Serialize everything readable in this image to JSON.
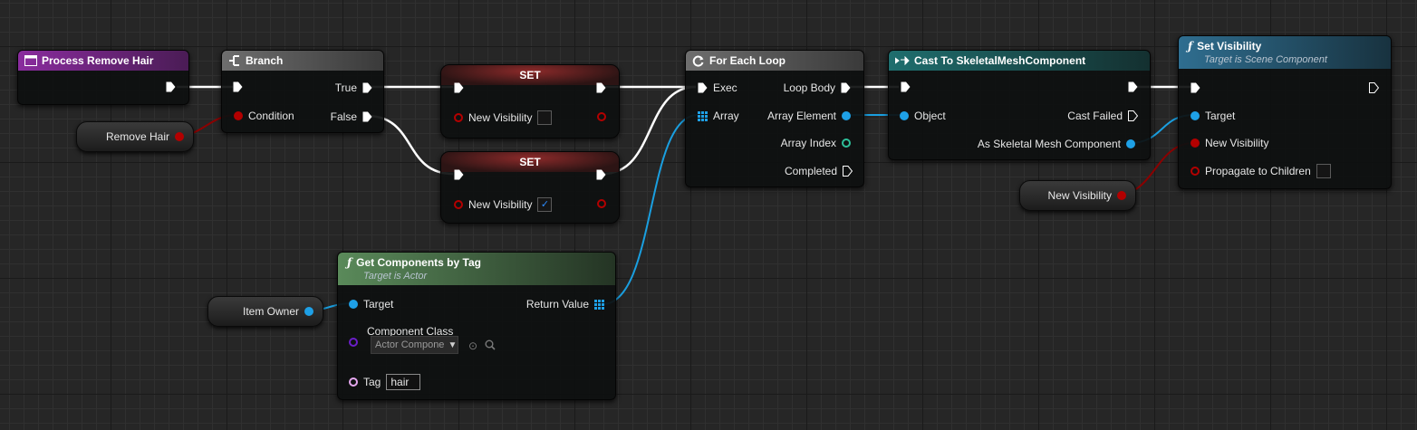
{
  "colors": {
    "event_header": "#8a2c9e",
    "branch_header": "#6e6e6e",
    "set_header": "#9b2424",
    "loop_header": "#6e6e6e",
    "cast_header": "#1f6e6e",
    "function_header": "#2c6e8c",
    "pure_function_header": "#4f7a4f",
    "exec_wire": "#ffffff",
    "bool_wire": "#8b0000",
    "object_wire": "#1a9fe0"
  },
  "nodes": {
    "event": {
      "title": "Process Remove Hair"
    },
    "branch": {
      "title": "Branch",
      "true_label": "True",
      "false_label": "False",
      "condition_label": "Condition"
    },
    "set_true": {
      "title": "SET",
      "pin_label": "New Visibility",
      "checked": false
    },
    "set_false": {
      "title": "SET",
      "pin_label": "New Visibility",
      "checked": true,
      "check_glyph": "✓"
    },
    "foreach": {
      "title": "For Each Loop",
      "exec": "Exec",
      "array": "Array",
      "loop_body": "Loop Body",
      "array_element": "Array Element",
      "array_index": "Array Index",
      "completed": "Completed"
    },
    "cast": {
      "title": "Cast To SkeletalMeshComponent",
      "object": "Object",
      "cast_failed": "Cast Failed",
      "as_output": "As Skeletal Mesh Component"
    },
    "set_visibility": {
      "title": "Set Visibility",
      "subtitle": "Target is Scene Component",
      "target": "Target",
      "new_visibility": "New Visibility",
      "propagate": "Propagate to Children",
      "propagate_checked": false
    },
    "get_components": {
      "title": "Get Components by Tag",
      "subtitle": "Target is Actor",
      "target": "Target",
      "return_value": "Return Value",
      "component_class": "Component Class",
      "class_value": "Actor Compone",
      "tag_label": "Tag",
      "tag_value": "hair"
    }
  },
  "getters": {
    "remove_hair": "Remove Hair",
    "item_owner": "Item Owner",
    "new_visibility": "New Visibility"
  },
  "icons": {
    "event": "event-icon",
    "branch": "branch-icon",
    "loop": "loop-icon",
    "cast": "cast-icon",
    "function": "function-icon"
  }
}
